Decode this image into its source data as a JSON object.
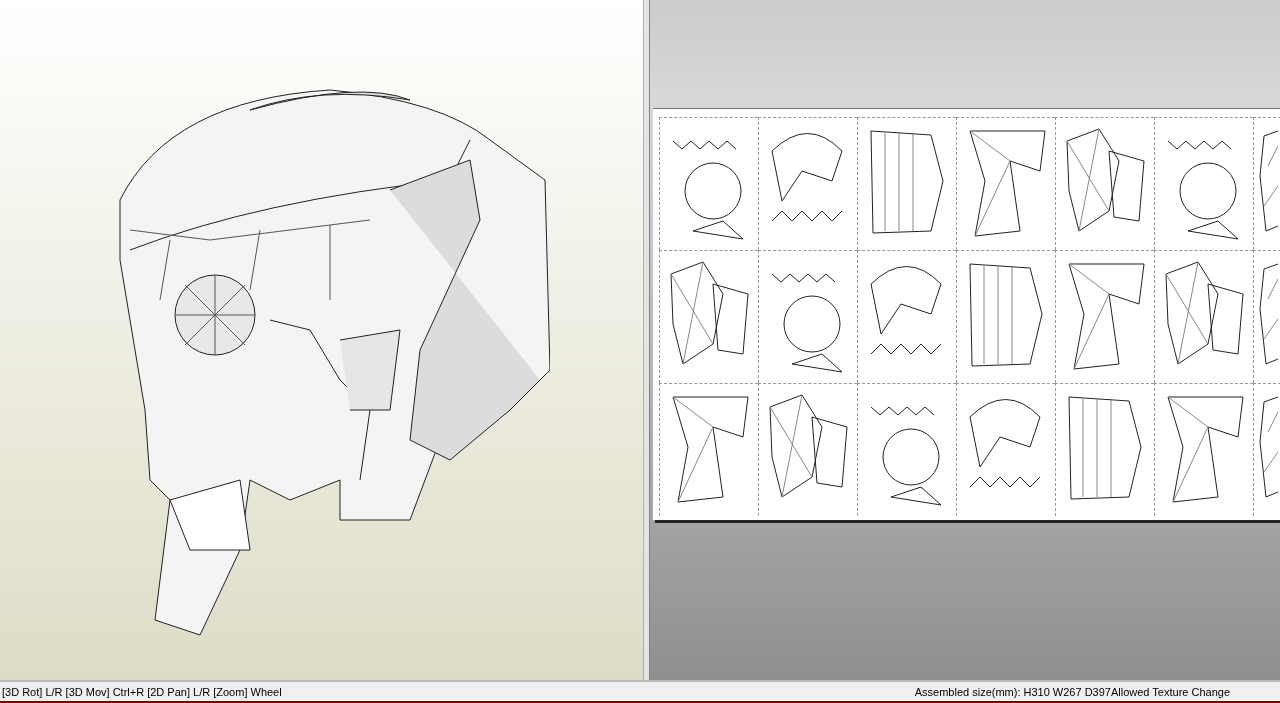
{
  "status_bar": {
    "controls_hint": "[3D Rot] L/R [3D Mov] Ctrl+R [2D Pan] L/R [Zoom] Wheel",
    "info": "Assembled size(mm): H310 W267 D397Allowed Texture Change"
  }
}
